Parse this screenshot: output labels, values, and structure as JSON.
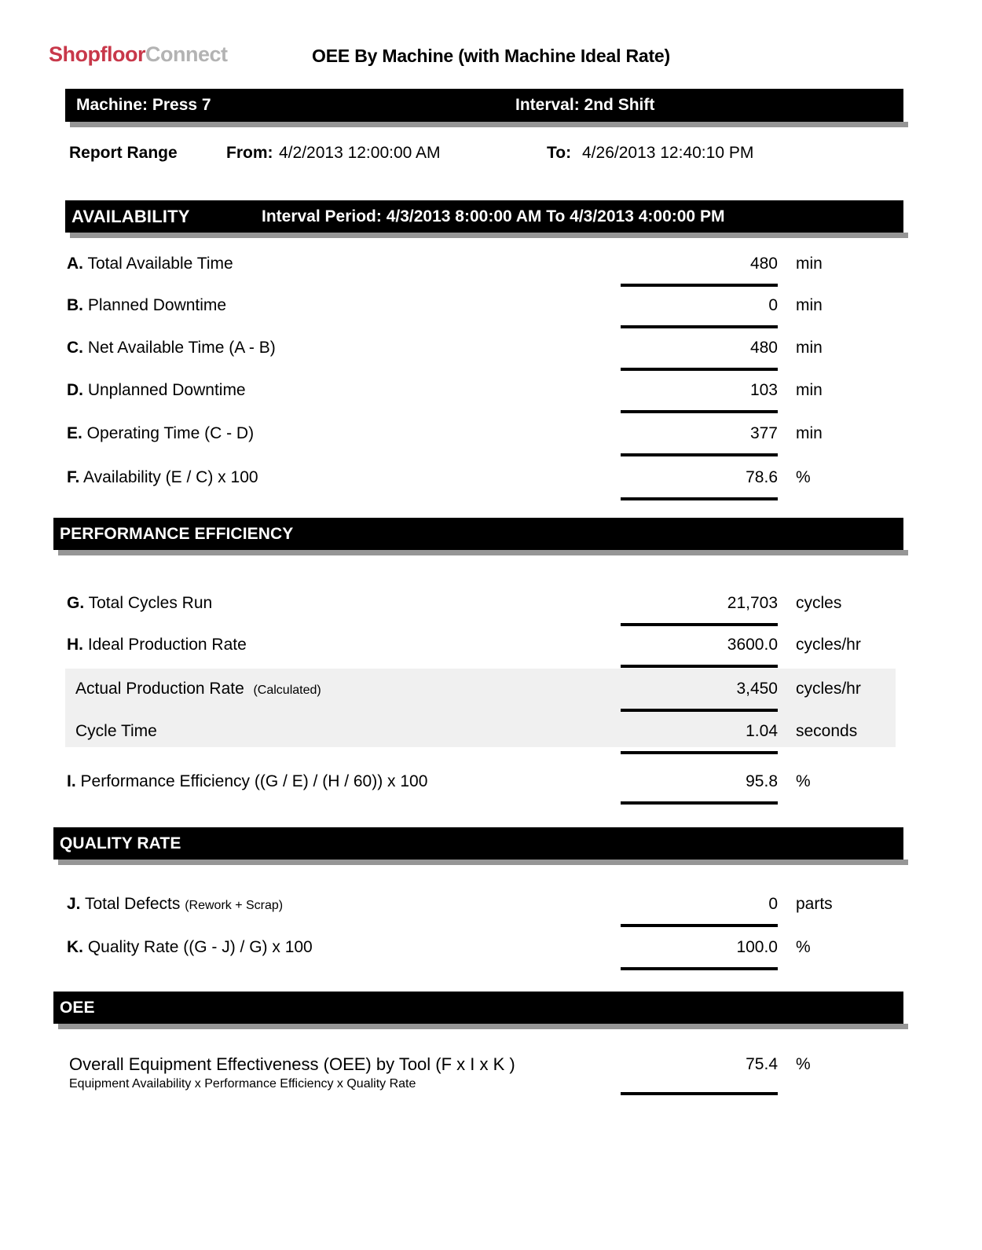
{
  "brand": {
    "primary": "Shopfloor",
    "secondary": "Connect",
    "primary_color": "#c8384a",
    "secondary_color": "#b3b3b3"
  },
  "header": {
    "report_title": "OEE By Machine (with Machine Ideal Rate)",
    "machine": "Machine: Press 7",
    "interval": "Interval: 2nd Shift"
  },
  "report_range": {
    "label": "Report Range",
    "from_label": "From:",
    "from_value": "4/2/2013 12:00:00 AM",
    "to_label": "To:",
    "to_value": "4/26/2013 12:40:10 PM"
  },
  "sections": {
    "availability": {
      "title": "AVAILABILITY",
      "interval_period": "Interval Period: 4/3/2013 8:00:00 AM  To  4/3/2013 4:00:00 PM",
      "rows": [
        {
          "key": "A.",
          "label": " Total Available Time",
          "value": "480",
          "unit": "min"
        },
        {
          "key": "B.",
          "label": " Planned Downtime",
          "value": "0",
          "unit": "min"
        },
        {
          "key": "C.",
          "label": " Net Available Time (A - B)",
          "value": "480",
          "unit": "min"
        },
        {
          "key": "D.",
          "label": " Unplanned Downtime",
          "value": "103",
          "unit": "min"
        },
        {
          "key": "E.",
          "label": " Operating Time (C - D)",
          "value": "377",
          "unit": "min"
        },
        {
          "key": "F.",
          "label": " Availability (E / C) x 100",
          "value": "78.6",
          "unit": "%"
        }
      ]
    },
    "performance": {
      "title": "PERFORMANCE EFFICIENCY",
      "rows": [
        {
          "key": "G.",
          "label": " Total Cycles Run",
          "value": "21,703",
          "unit": "cycles"
        },
        {
          "key": "H.",
          "label": " Ideal Production Rate",
          "value": "3600.0",
          "unit": "cycles/hr"
        }
      ],
      "calculated_rows": [
        {
          "key": "",
          "label": "Actual Production Rate",
          "note": "(Calculated)",
          "value": "3,450",
          "unit": "cycles/hr"
        },
        {
          "key": "",
          "label": "Cycle Time",
          "note": "",
          "value": "1.04",
          "unit": "seconds"
        }
      ],
      "summary_row": {
        "key": "I.",
        "label": " Performance Efficiency ((G / E) / (H / 60)) x 100",
        "value": "95.8",
        "unit": "%"
      }
    },
    "quality": {
      "title": "QUALITY RATE",
      "rows": [
        {
          "key": "J.",
          "label": " Total Defects ",
          "note": "(Rework + Scrap)",
          "value": "0",
          "unit": "parts"
        },
        {
          "key": "K.",
          "label": " Quality Rate ((G - J) / G) x 100",
          "note": "",
          "value": "100.0",
          "unit": "%"
        }
      ]
    },
    "oee": {
      "title": "OEE",
      "label": "Overall Equipment Effectiveness (OEE) by Tool  (F x I x K )",
      "sublabel": "Equipment Availability x Performance Efficiency x Quality Rate",
      "value": "75.4",
      "unit": "%"
    }
  }
}
